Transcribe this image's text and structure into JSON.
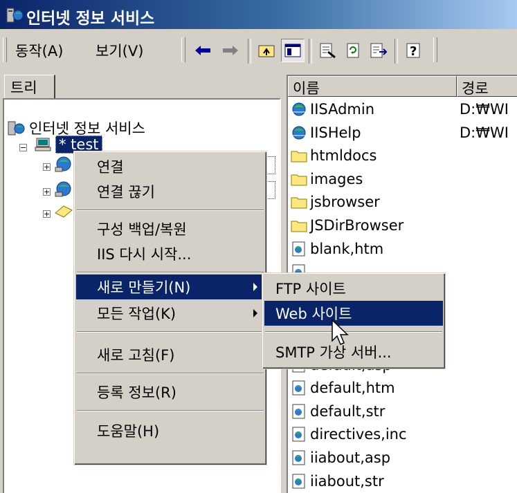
{
  "window": {
    "title": "인터넷 정보 서비스"
  },
  "menubar": {
    "action": "동작(A)",
    "view": "보기(V)"
  },
  "toolbar": {
    "icons": [
      "back-arrow-icon",
      "forward-arrow-icon",
      "up-folder-icon",
      "show-tree-icon",
      "properties-icon",
      "refresh-icon",
      "export-list-icon",
      "help-icon"
    ]
  },
  "tree": {
    "tab_label": "트리",
    "root_label": "인터넷 정보 서비스",
    "server_label": "* test"
  },
  "list": {
    "col_name": "이름",
    "col_path": "경로",
    "rows": [
      {
        "name": "IISAdmin",
        "path": "D:₩WI",
        "type": "web"
      },
      {
        "name": "IISHelp",
        "path": "D:₩WI",
        "type": "web"
      },
      {
        "name": "htmldocs",
        "path": "",
        "type": "folder"
      },
      {
        "name": "images",
        "path": "",
        "type": "folder"
      },
      {
        "name": "jsbrowser",
        "path": "",
        "type": "folder"
      },
      {
        "name": "JSDirBrowser",
        "path": "",
        "type": "folder"
      },
      {
        "name": "blank,htm",
        "path": "",
        "type": "file"
      },
      {
        "name": "",
        "path": "",
        "type": "file"
      },
      {
        "name": "",
        "path": "",
        "type": "file"
      },
      {
        "name": "",
        "path": "",
        "type": "file"
      },
      {
        "name": "",
        "path": "",
        "type": "file"
      },
      {
        "name": "default,asp",
        "path": "",
        "type": "file"
      },
      {
        "name": "default,htm",
        "path": "",
        "type": "file"
      },
      {
        "name": "default,str",
        "path": "",
        "type": "file"
      },
      {
        "name": "directives,inc",
        "path": "",
        "type": "file"
      },
      {
        "name": "iiabout,asp",
        "path": "",
        "type": "file"
      },
      {
        "name": "iiabout,str",
        "path": "",
        "type": "file"
      }
    ]
  },
  "context_menu": {
    "items": [
      "연결",
      "연결 끊기",
      "구성 백업/복원",
      "IIS 다시 시작...",
      "새로 만들기(N)",
      "모든 작업(K)",
      "새로 고침(F)",
      "등록 정보(R)",
      "도움말(H)"
    ]
  },
  "submenu": {
    "items": [
      "FTP 사이트",
      "Web 사이트",
      "SMTP 가상 서버..."
    ]
  },
  "colors": {
    "selection": "#0a246a",
    "face": "#d4d0c8"
  }
}
